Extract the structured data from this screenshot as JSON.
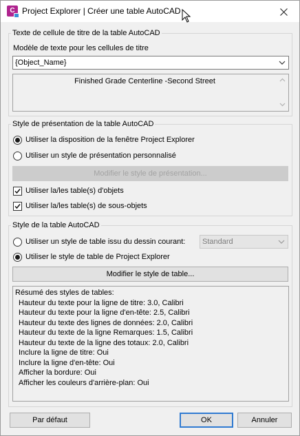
{
  "window": {
    "title": "Project Explorer | Créer une table AutoCAD",
    "app_icon_letter": "C"
  },
  "title_group": {
    "legend": "Texte de cellule de titre de la table AutoCAD",
    "template_label": "Modèle de texte pour les cellules de titre",
    "template_value": "{Object_Name}",
    "preview_text": "Finished Grade Centerline -Second Street"
  },
  "presentation_group": {
    "legend": "Style de présentation de la table AutoCAD",
    "radio_use_layout": "Utiliser la disposition de la fenêtre Project Explorer",
    "radio_custom": "Utiliser un style de présentation personnalisé",
    "modify_button": "Modifier le style de présentation...",
    "check_objects": "Utiliser la/les table(s) d'objets",
    "check_subobjects": "Utiliser la/les table(s) de sous-objets"
  },
  "table_style_group": {
    "legend": "Style de la table AutoCAD",
    "radio_drawing_style": "Utiliser un style de table issu du dessin courant:",
    "drawing_style_value": "Standard",
    "radio_pe_style": "Utiliser le style de table de Project Explorer",
    "modify_button": "Modifier le style de table...",
    "summary_header": "Résumé des styles de tables:",
    "summary_lines": [
      "Hauteur du texte pour la ligne de titre: 3.0, Calibri",
      "Hauteur du texte pour la ligne d'en-tête: 2.5, Calibri",
      "Hauteur du texte des lignes de données: 2.0, Calibri",
      "Hauteur du texte de la ligne Remarques: 1.5, Calibri",
      "Hauteur du texte de la ligne des totaux: 2.0, Calibri",
      "Inclure la ligne de titre: Oui",
      "Inclure la ligne d'en-tête: Oui",
      "Afficher la bordure: Oui",
      "Afficher les couleurs d'arrière-plan: Oui"
    ]
  },
  "footer": {
    "default_button": "Par défaut",
    "ok_button": "OK",
    "cancel_button": "Annuler"
  },
  "colors": {
    "accent": "#2f7ad1",
    "app_icon": "#b0248f"
  }
}
